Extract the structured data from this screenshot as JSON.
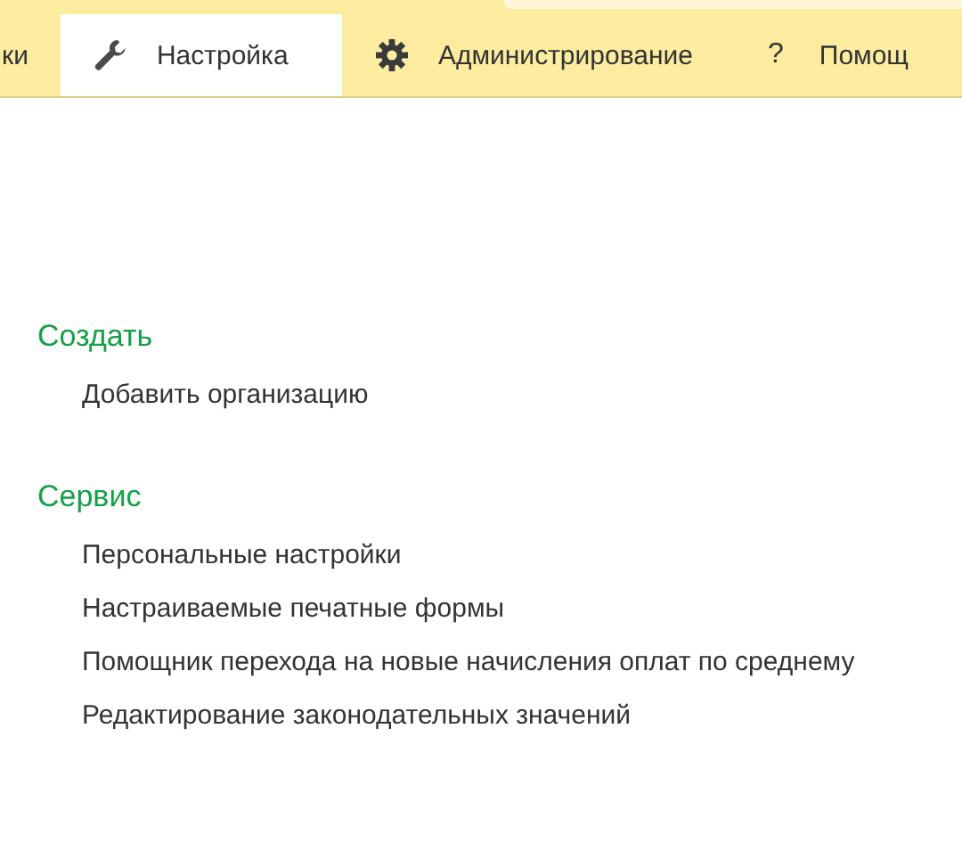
{
  "tabs": [
    {
      "label": "ки",
      "kind": "plain",
      "selected": false
    },
    {
      "label": "Настройка",
      "kind": "wrench",
      "selected": true
    },
    {
      "label": "Администрирование",
      "kind": "gear",
      "selected": false
    },
    {
      "label": "Помощ",
      "kind": "char",
      "glyph": "?",
      "selected": false
    }
  ],
  "sections": [
    {
      "title": "Создать",
      "items": [
        "Добавить организацию"
      ]
    },
    {
      "title": "Сервис",
      "items": [
        "Персональные настройки",
        "Настраиваемые печатные формы",
        "Помощник перехода на новые начисления оплат по среднему",
        "Редактирование законодательных значений"
      ]
    }
  ]
}
